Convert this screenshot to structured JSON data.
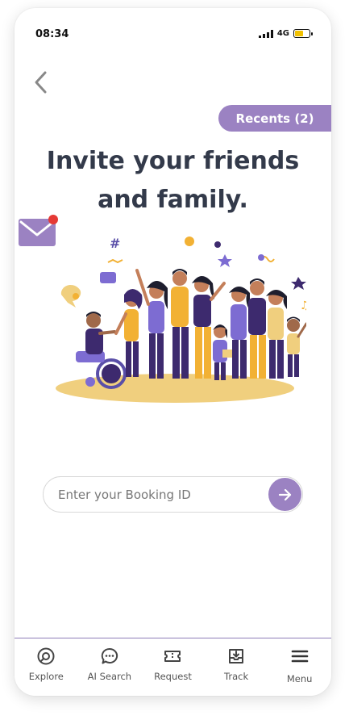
{
  "status": {
    "time": "08:34",
    "network": "4G",
    "battery_level": 0.6
  },
  "recents_label": "Recents (2)",
  "title": {
    "line1": "Invite your friends",
    "line2": "and family."
  },
  "booking": {
    "placeholder": "Enter your Booking ID",
    "value": ""
  },
  "nav": [
    {
      "label": "Explore",
      "icon": "compass-icon"
    },
    {
      "label": "AI Search",
      "icon": "chat-bubble-icon"
    },
    {
      "label": "Request",
      "icon": "ticket-icon"
    },
    {
      "label": "Track",
      "icon": "tray-download-icon"
    },
    {
      "label": "Menu",
      "icon": "hamburger-icon"
    }
  ],
  "colors": {
    "accent": "#9b82c2",
    "title": "#333a4a",
    "badge": "#e53935"
  }
}
